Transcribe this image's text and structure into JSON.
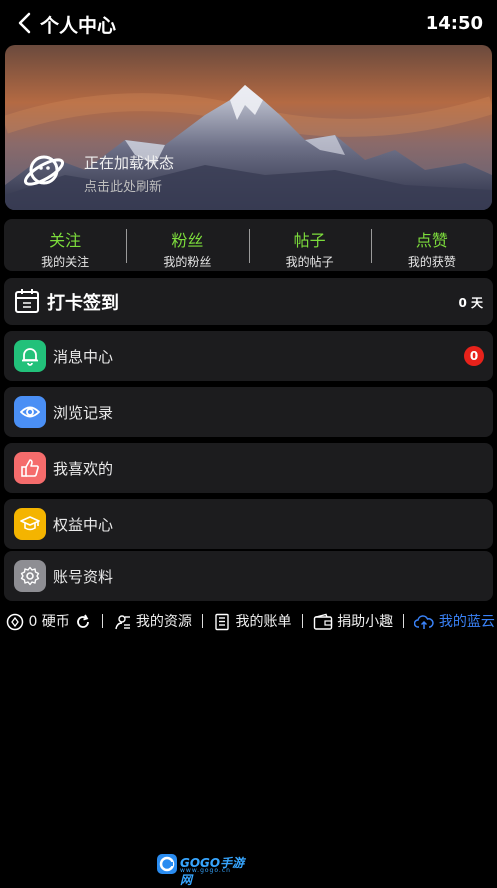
{
  "header": {
    "title": "个人中心",
    "time": "14:50"
  },
  "banner": {
    "title": "正在加载状态",
    "subtitle": "点击此处刷新"
  },
  "stats": [
    {
      "title": "关注",
      "label": "我的关注"
    },
    {
      "title": "粉丝",
      "label": "我的粉丝"
    },
    {
      "title": "帖子",
      "label": "我的帖子"
    },
    {
      "title": "点赞",
      "label": "我的获赞"
    }
  ],
  "signin": {
    "label": "打卡签到",
    "days": "0 天"
  },
  "menu": [
    {
      "label": "消息中心",
      "color": "#22c17a",
      "icon": "bell-icon",
      "badge": "0"
    },
    {
      "label": "浏览记录",
      "color": "#4a8ff5",
      "icon": "eye-icon"
    },
    {
      "label": "我喜欢的",
      "color": "#f56c6c",
      "icon": "thumbs-up-icon"
    },
    {
      "label": "权益中心",
      "color": "#f4b400",
      "icon": "graduation-cap-icon"
    },
    {
      "label": "账号资料",
      "color": "#8e8e93",
      "icon": "gear-icon"
    }
  ],
  "bottom": {
    "coins": "0 硬币",
    "resources": "我的资源",
    "bills": "我的账单",
    "donate": "捐助小趣",
    "cloud": "我的蓝云"
  },
  "watermark": {
    "brand": "GOGO手游网",
    "domain": "www.gogo.cn"
  }
}
